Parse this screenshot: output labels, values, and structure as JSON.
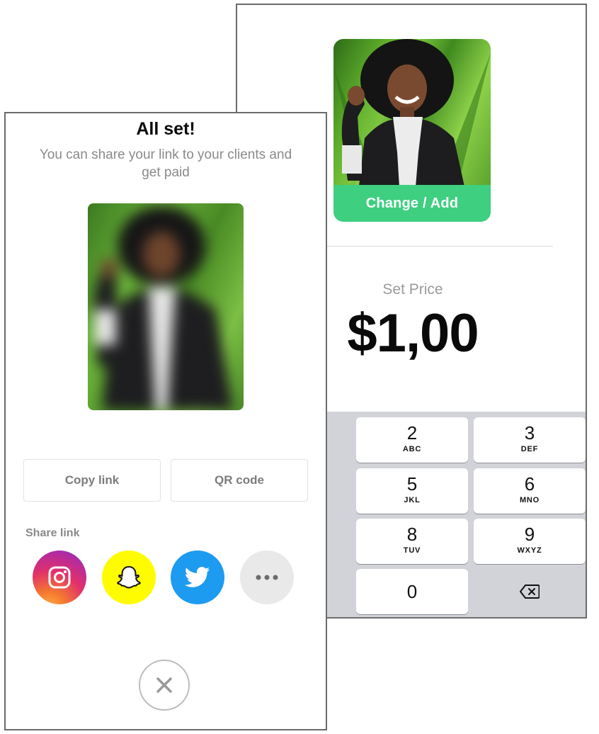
{
  "price_screen": {
    "change_add_label": "Change / Add",
    "set_price_label": "Set Price",
    "price_value": "$1,00",
    "keypad": [
      {
        "digit": "2",
        "letters": "ABC"
      },
      {
        "digit": "3",
        "letters": "DEF"
      },
      {
        "digit": "5",
        "letters": "JKL"
      },
      {
        "digit": "6",
        "letters": "MNO"
      },
      {
        "digit": "8",
        "letters": "TUV"
      },
      {
        "digit": "9",
        "letters": "WXYZ"
      },
      {
        "digit": "0",
        "letters": ""
      }
    ],
    "colors": {
      "accent_green": "#3ecf80",
      "keypad_bg": "#d1d3d9"
    }
  },
  "share_screen": {
    "title": "All set!",
    "subtitle": "You can share your link to your clients and get paid",
    "copy_link_label": "Copy link",
    "qr_code_label": "QR code",
    "share_link_label": "Share link",
    "share_icons": [
      "instagram-icon",
      "snapchat-icon",
      "twitter-icon",
      "more-icon"
    ],
    "colors": {
      "snapchat": "#fffc00",
      "twitter": "#1da1f2",
      "more_bg": "#e9e9e9"
    }
  }
}
